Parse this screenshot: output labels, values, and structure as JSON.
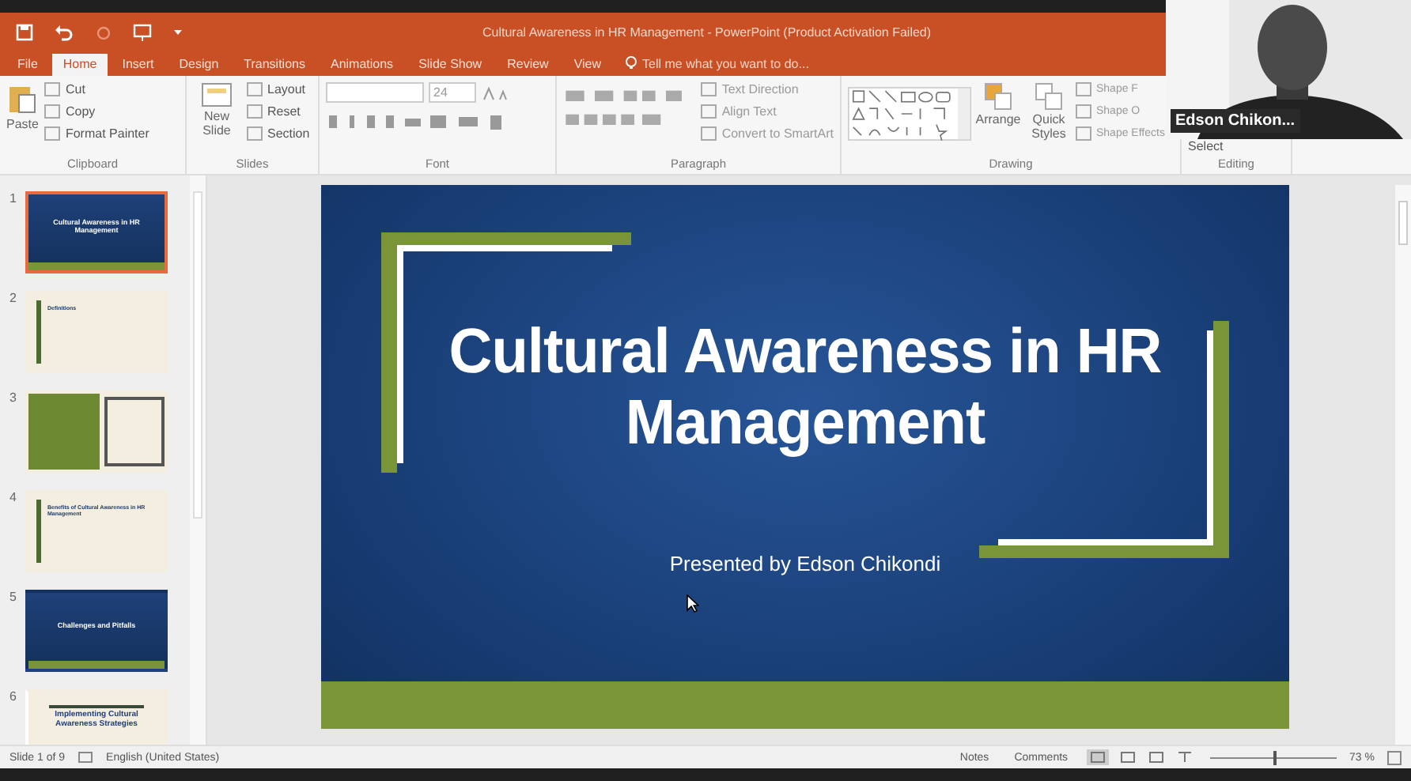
{
  "window": {
    "title": "Cultural Awareness in HR Management - PowerPoint (Product Activation Failed)"
  },
  "menu_tabs": [
    {
      "label": "File",
      "selected": false
    },
    {
      "label": "Home",
      "selected": true
    },
    {
      "label": "Insert",
      "selected": false
    },
    {
      "label": "Design",
      "selected": false
    },
    {
      "label": "Transitions",
      "selected": false
    },
    {
      "label": "Animations",
      "selected": false
    },
    {
      "label": "Slide Show",
      "selected": false
    },
    {
      "label": "Review",
      "selected": false
    },
    {
      "label": "View",
      "selected": false
    }
  ],
  "tell_me": {
    "placeholder": "Tell me what you want to do..."
  },
  "clipboard": {
    "label": "Clipboard",
    "big": "Paste",
    "items": [
      "Cut",
      "Copy",
      "Format Painter"
    ]
  },
  "slides_group": {
    "label": "Slides",
    "big": "New Slide",
    "items": [
      "Layout",
      "Reset",
      "Section"
    ]
  },
  "font": {
    "label": "Font",
    "size": "24"
  },
  "paragraph": {
    "label": "Paragraph",
    "items": [
      "Text Direction",
      "Align Text",
      "Convert to SmartArt"
    ]
  },
  "drawing": {
    "label": "Drawing",
    "buttons": [
      "Arrange",
      "Quick Styles"
    ],
    "items": [
      "Shape F",
      "Shape O",
      "Shape Effects"
    ]
  },
  "editing": {
    "label": "Editing",
    "items": [
      "Select"
    ]
  },
  "video": {
    "name": "Edson Chikon..."
  },
  "thumbnails": [
    {
      "number": "1",
      "selected": true,
      "kind": "title",
      "title": "Cultural Awareness in HR Management"
    },
    {
      "number": "2",
      "selected": false,
      "kind": "content",
      "title": "Definitions"
    },
    {
      "number": "3",
      "selected": false,
      "kind": "split"
    },
    {
      "number": "4",
      "selected": false,
      "kind": "content",
      "title": "Benefits of Cultural Awareness in HR Management"
    },
    {
      "number": "5",
      "selected": false,
      "kind": "title",
      "title": "Challenges and Pitfalls"
    },
    {
      "number": "6",
      "selected": false,
      "kind": "framed",
      "title": "Implementing Cultural Awareness Strategies"
    }
  ],
  "slide": {
    "title": "Cultural Awareness in HR Management",
    "subtitle": "Presented by Edson Chikondi"
  },
  "status_bar": {
    "slide": "Slide 1 of 9",
    "language": "English (United States)",
    "notes": "Notes",
    "comments": "Comments",
    "zoom": "73 %",
    "zoom_slider": {
      "level": 0.5
    }
  }
}
